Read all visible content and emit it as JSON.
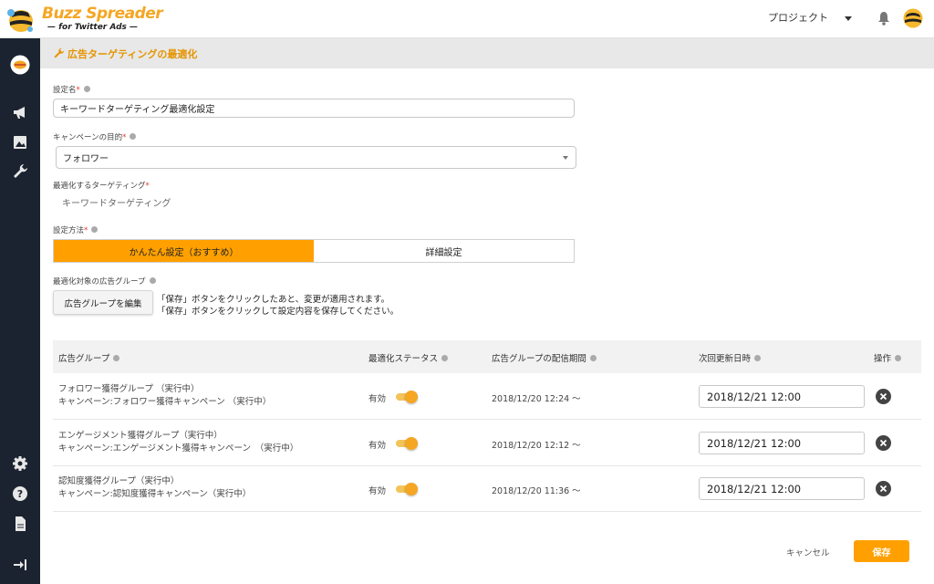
{
  "header": {
    "logo_title": "Buzz Spreader",
    "logo_subtitle": "— for Twitter Ads —",
    "project_label": "プロジェクト"
  },
  "page": {
    "title": "広告ターゲティングの最適化"
  },
  "form": {
    "setting_name_label": "設定名",
    "setting_name_value": "キーワードターゲティング最適化設定",
    "campaign_goal_label": "キャンペーンの目的",
    "campaign_goal_value": "フォロワー",
    "targeting_label": "最適化するターゲティング",
    "targeting_value": "キーワードターゲティング",
    "method_label": "設定方法",
    "method_easy": "かんたん設定（おすすめ）",
    "method_detail": "詳細設定",
    "ad_groups_label": "最適化対象の広告グループ",
    "edit_groups_button": "広告グループを編集",
    "note_line1": "「保存」ボタンをクリックしたあと、変更が適用されます。",
    "note_line2": "「保存」ボタンをクリックして設定内容を保存してください。",
    "required_mark": "*"
  },
  "table": {
    "headers": [
      "広告グループ",
      "最適化ステータス",
      "広告グループの配信期間",
      "次回更新日時",
      "操作"
    ],
    "rows": [
      {
        "group": "フォロワー獲得グループ （実行中）",
        "campaign": "キャンペーン:フォロワー獲得キャンペーン （実行中）",
        "status": "有効",
        "period": "2018/12/20 12:24 〜",
        "next_update": "2018/12/21 12:00"
      },
      {
        "group": "エンゲージメント獲得グループ（実行中）",
        "campaign": "キャンペーン:エンゲージメント獲得キャンペーン　（実行中）",
        "status": "有効",
        "period": "2018/12/20 12:12 〜",
        "next_update": "2018/12/21 12:00"
      },
      {
        "group": "認知度獲得グループ（実行中）",
        "campaign": "キャンペーン:認知度獲得キャンペーン（実行中）",
        "status": "有効",
        "period": "2018/12/20 11:36 〜",
        "next_update": "2018/12/21 12:00"
      }
    ]
  },
  "footer": {
    "cancel_label": "キャンセル",
    "save_label": "保存"
  },
  "colors": {
    "accent": "#ffa000",
    "sidebar": "#1b2330",
    "title_orange": "#e59400"
  },
  "icons": {
    "sidebar": [
      "brand-icon",
      "megaphone-icon",
      "image-icon",
      "wrench-icon",
      "gear-icon",
      "help-icon",
      "document-icon",
      "logout-icon"
    ]
  }
}
